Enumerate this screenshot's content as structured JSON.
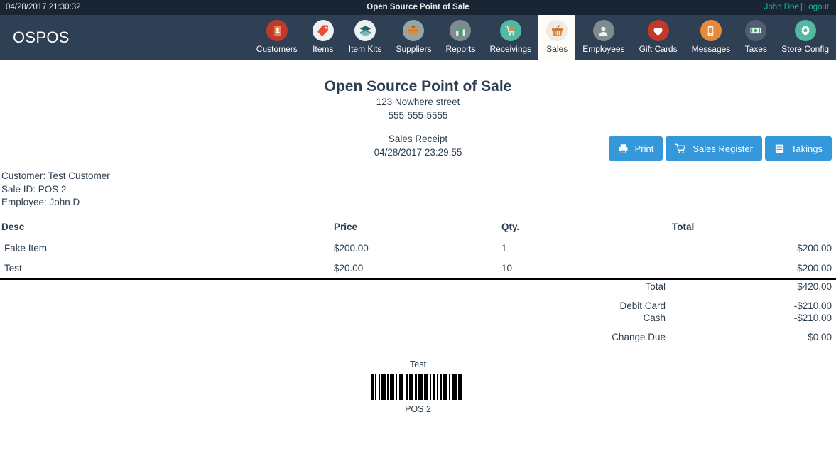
{
  "topbar": {
    "datetime": "04/28/2017 21:30:32",
    "title": "Open Source Point of Sale",
    "user": "John Doe",
    "separator": "|",
    "logout": "Logout"
  },
  "navbar": {
    "brand": "OSPOS",
    "items": [
      {
        "label": "Customers",
        "icon": "customers-icon",
        "color": "#c0392b",
        "active": false
      },
      {
        "label": "Items",
        "icon": "items-tag-icon",
        "color": "#ecf0f1",
        "active": false
      },
      {
        "label": "Item Kits",
        "icon": "item-kits-icon",
        "color": "#ecf0f1",
        "active": false
      },
      {
        "label": "Suppliers",
        "icon": "briefcase-icon",
        "color": "#95a5a6",
        "active": false
      },
      {
        "label": "Reports",
        "icon": "bar-chart-icon",
        "color": "#7f8c8d",
        "active": false
      },
      {
        "label": "Receivings",
        "icon": "receivings-icon",
        "color": "#52b9a0",
        "active": false
      },
      {
        "label": "Sales",
        "icon": "sales-basket-icon",
        "color": "#f0ebe2",
        "active": true
      },
      {
        "label": "Employees",
        "icon": "employee-icon",
        "color": "#7f8c8d",
        "active": false
      },
      {
        "label": "Gift Cards",
        "icon": "heart-icon",
        "color": "#c0392b",
        "active": false
      },
      {
        "label": "Messages",
        "icon": "phone-icon",
        "color": "#e8893c",
        "active": false
      },
      {
        "label": "Taxes",
        "icon": "money-icon",
        "color": "#4e6070",
        "active": false
      },
      {
        "label": "Store Config",
        "icon": "gear-icon",
        "color": "#52b9a0",
        "active": false
      }
    ]
  },
  "actions": [
    {
      "label": "Print",
      "icon": "printer-icon"
    },
    {
      "label": "Sales Register",
      "icon": "cart-icon"
    },
    {
      "label": "Takings",
      "icon": "list-icon"
    }
  ],
  "receipt": {
    "store_name": "Open Source Point of Sale",
    "address": "123 Nowhere street",
    "phone": "555-555-5555",
    "doc_type": "Sales Receipt",
    "timestamp": "04/28/2017 23:29:55",
    "meta": [
      "Customer: Test Customer",
      "Sale ID: POS 2",
      "Employee: John D"
    ],
    "table": {
      "headers": [
        "Desc",
        "Price",
        "Qty.",
        "Total"
      ],
      "rows": [
        {
          "desc": "Fake Item",
          "price": "$200.00",
          "qty": "1",
          "total": "$200.00"
        },
        {
          "desc": "Test",
          "price": "$20.00",
          "qty": "10",
          "total": "$200.00"
        }
      ]
    },
    "summary": [
      {
        "label": "Total",
        "value": "$420.00",
        "spaced": false
      },
      {
        "label": "Debit Card",
        "value": "-$210.00",
        "spaced": true
      },
      {
        "label": "Cash",
        "value": "-$210.00",
        "spaced": false
      },
      {
        "label": "Change Due",
        "value": "$0.00",
        "spaced": true
      }
    ],
    "barcode": {
      "label": "Test",
      "code": "POS 2",
      "pattern": [
        3,
        2,
        2,
        3,
        2,
        2,
        6,
        2,
        2,
        2,
        6,
        2,
        2,
        3,
        6,
        3,
        3,
        2,
        6,
        2,
        3,
        2,
        6,
        2,
        6,
        2,
        2,
        3,
        3,
        2,
        2,
        2,
        3,
        2,
        6,
        2,
        2,
        3,
        6,
        2,
        6,
        3
      ]
    }
  },
  "colors": {
    "topbar_bg": "#1a2533",
    "navbar_bg": "#2f3f54",
    "accent_link": "#18bc9c",
    "button_blue": "#3498db",
    "text": "#2c3e50",
    "active_tab_bg": "#fdfcf7"
  }
}
